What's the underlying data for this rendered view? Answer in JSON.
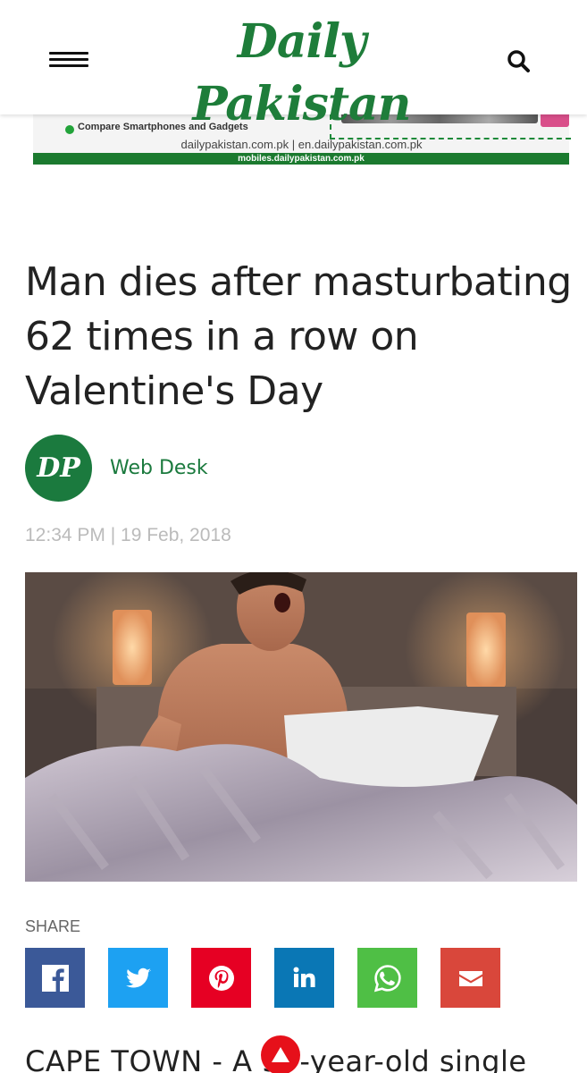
{
  "header": {
    "logo": "Daily Pakistan",
    "sub_links": "dailypakistan.com.pk   |   en.dailypakistan.com.pk"
  },
  "ad": {
    "text": "Compare Smartphones and Gadgets",
    "url": "mobiles.dailypakistan.com.pk"
  },
  "article": {
    "title": "Man dies after masturbating 62 times in a row on Valentine's Day",
    "author": {
      "initials": "DP",
      "name": "Web Desk"
    },
    "date": "12:34 PM | 19 Feb, 2018",
    "body_start": "CAPE TOWN - A 3  -year-old single"
  },
  "share": {
    "label": "SHARE",
    "buttons": [
      {
        "name": "facebook",
        "icon": "facebook-icon",
        "color": "#3b5998"
      },
      {
        "name": "twitter",
        "icon": "twitter-icon",
        "color": "#1da1f2"
      },
      {
        "name": "pinterest",
        "icon": "pinterest-icon",
        "color": "#e60023"
      },
      {
        "name": "linkedin",
        "icon": "linkedin-icon",
        "color": "#0a77b5"
      },
      {
        "name": "whatsapp",
        "icon": "whatsapp-icon",
        "color": "#4fbf45"
      },
      {
        "name": "email",
        "icon": "email-icon",
        "color": "#d9473b"
      }
    ]
  },
  "colors": {
    "brand_green": "#1e7d3a",
    "scroll_top_red": "#e6101a"
  }
}
